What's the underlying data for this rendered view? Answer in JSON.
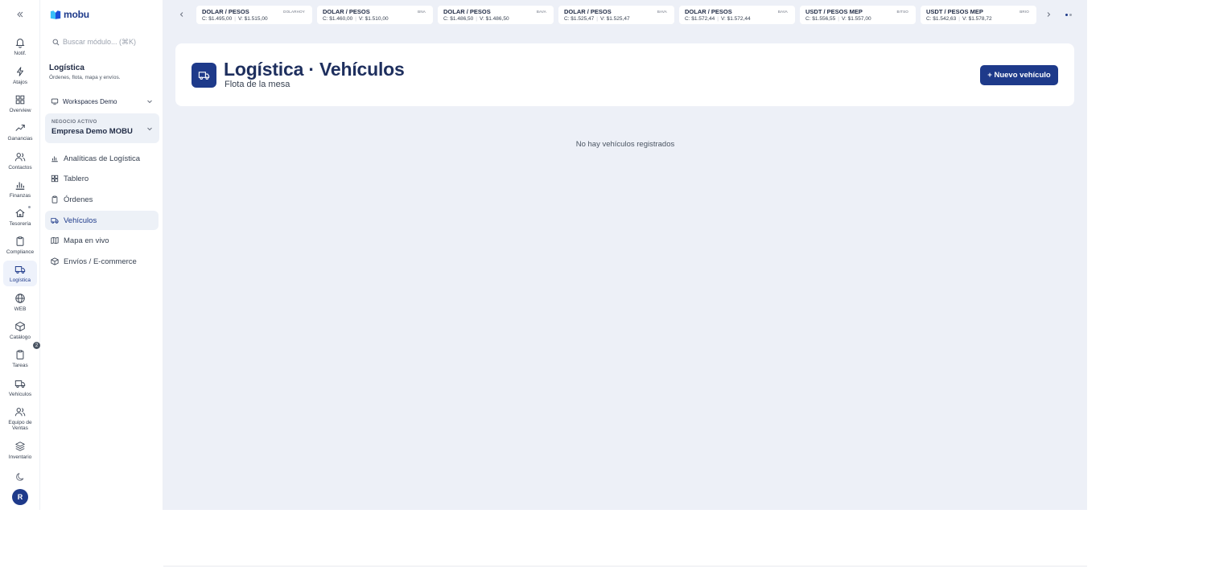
{
  "brand": {
    "name": "mobu"
  },
  "rail": {
    "items": [
      {
        "id": "notif",
        "label": "Notif.",
        "icon": "bell-icon"
      },
      {
        "id": "atajos",
        "label": "Atajos",
        "icon": "lightning-icon"
      },
      {
        "id": "overview",
        "label": "Overview",
        "icon": "grid-icon"
      },
      {
        "id": "ganancias",
        "label": "Ganancias",
        "icon": "trend-up-icon"
      },
      {
        "id": "contactos",
        "label": "Contactos",
        "icon": "users-icon"
      },
      {
        "id": "finanzas",
        "label": "Finanzas",
        "icon": "bar-chart-icon"
      },
      {
        "id": "tesoreria",
        "label": "Tesorería",
        "icon": "home-icon"
      },
      {
        "id": "compliance",
        "label": "Compliance",
        "icon": "clipboard-icon"
      },
      {
        "id": "logistica",
        "label": "Logística",
        "icon": "truck-icon",
        "active": true
      },
      {
        "id": "web",
        "label": "WEB",
        "icon": "globe-icon"
      },
      {
        "id": "catalogo",
        "label": "Catálogo",
        "icon": "box-icon"
      },
      {
        "id": "tareas",
        "label": "Tareas",
        "icon": "clipboard-check-icon",
        "badge": "2"
      },
      {
        "id": "vehiculos",
        "label": "Vehículos",
        "icon": "truck-icon"
      },
      {
        "id": "equipo",
        "label": "Equipo de Ventas",
        "icon": "users-icon"
      },
      {
        "id": "inventario",
        "label": "Inventario",
        "icon": "layers-icon"
      }
    ],
    "avatar_initial": "R"
  },
  "panel": {
    "search_placeholder": "Buscar módulo... (⌘K)",
    "title": "Logística",
    "subtitle": "Órdenes, flota, mapa y envíos.",
    "workspace": "Workspaces Demo",
    "business_label": "NEGOCIO ACTIVO",
    "business_name": "Empresa Demo MOBU",
    "nav": [
      {
        "label": "Analíticas de Logística",
        "icon": "bar-chart-icon"
      },
      {
        "label": "Tablero",
        "icon": "grid-icon"
      },
      {
        "label": "Órdenes",
        "icon": "clipboard-icon"
      },
      {
        "label": "Vehículos",
        "icon": "truck-icon",
        "active": true
      },
      {
        "label": "Mapa en vivo",
        "icon": "map-icon"
      },
      {
        "label": "Envíos / E-commerce",
        "icon": "box-icon"
      }
    ]
  },
  "ticker": {
    "quotes": [
      {
        "pair": "DOLAR / PESOS",
        "source": "DOLARHOY",
        "buy": "C: $1.495,00",
        "sell": "V: $1.515,00"
      },
      {
        "pair": "DOLAR / PESOS",
        "source": "BNA",
        "buy": "C: $1.460,00",
        "sell": "V: $1.510,00"
      },
      {
        "pair": "DOLAR / PESOS",
        "source": "BAVA",
        "buy": "C: $1.486,50",
        "sell": "V: $1.486,50"
      },
      {
        "pair": "DOLAR / PESOS",
        "source": "BAVA",
        "buy": "C: $1.525,47",
        "sell": "V: $1.525,47"
      },
      {
        "pair": "DOLAR / PESOS",
        "source": "BAVA",
        "buy": "C: $1.572,44",
        "sell": "V: $1.572,44"
      },
      {
        "pair": "USDT / PESOS MEP",
        "source": "BITSO",
        "buy": "C: $1.556,55",
        "sell": "V: $1.557,00"
      },
      {
        "pair": "USDT / PESOS MEP",
        "source": "BRIO",
        "buy": "C: $1.542,63",
        "sell": "V: $1.578,72"
      }
    ]
  },
  "main": {
    "title": "Logística · Vehículos",
    "subtitle": "Flota de la mesa",
    "new_button": "+ Nuevo vehículo",
    "empty_message": "No hay vehículos registrados"
  },
  "colors": {
    "accent": "#1e3a8a",
    "background": "#edf0f7",
    "active_bg": "#edf1f7"
  }
}
